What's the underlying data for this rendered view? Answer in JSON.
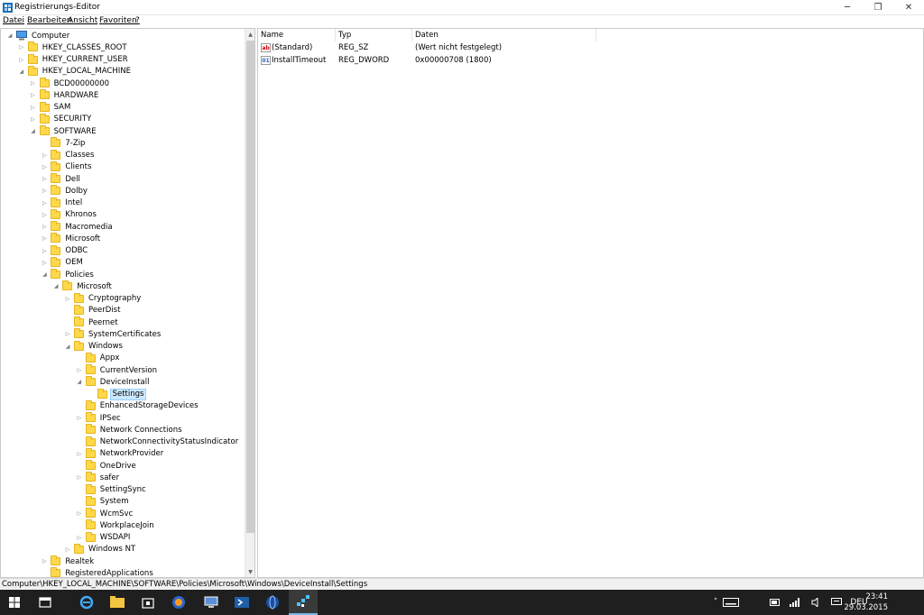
{
  "window": {
    "title": "Registrierungs-Editor",
    "minimize": "─",
    "maximize": "❐",
    "close": "✕"
  },
  "menu": [
    "Datei",
    "Bearbeiten",
    "Ansicht",
    "Favoriten",
    "?"
  ],
  "tree": {
    "items": [
      {
        "label": "Computer",
        "expander": "◢"
      },
      {
        "label": "HKEY_CLASSES_ROOT",
        "expander": "▷"
      },
      {
        "label": "HKEY_CURRENT_USER",
        "expander": "▷"
      },
      {
        "label": "HKEY_LOCAL_MACHINE",
        "expander": "◢"
      },
      {
        "label": "BCD00000000",
        "expander": "▷"
      },
      {
        "label": "HARDWARE",
        "expander": "▷"
      },
      {
        "label": "SAM",
        "expander": "▷"
      },
      {
        "label": "SECURITY",
        "expander": "▷"
      },
      {
        "label": "SOFTWARE",
        "expander": "◢"
      },
      {
        "label": "7-Zip",
        "expander": ""
      },
      {
        "label": "Classes",
        "expander": "▷"
      },
      {
        "label": "Clients",
        "expander": "▷"
      },
      {
        "label": "Dell",
        "expander": "▷"
      },
      {
        "label": "Dolby",
        "expander": "▷"
      },
      {
        "label": "Intel",
        "expander": "▷"
      },
      {
        "label": "Khronos",
        "expander": "▷"
      },
      {
        "label": "Macromedia",
        "expander": "▷"
      },
      {
        "label": "Microsoft",
        "expander": "▷"
      },
      {
        "label": "ODBC",
        "expander": "▷"
      },
      {
        "label": "OEM",
        "expander": "▷"
      },
      {
        "label": "Policies",
        "expander": "◢"
      },
      {
        "label": "Microsoft",
        "expander": "◢"
      },
      {
        "label": "Cryptography",
        "expander": "▷"
      },
      {
        "label": "PeerDist",
        "expander": ""
      },
      {
        "label": "Peernet",
        "expander": ""
      },
      {
        "label": "SystemCertificates",
        "expander": "▷"
      },
      {
        "label": "Windows",
        "expander": "◢"
      },
      {
        "label": "Appx",
        "expander": ""
      },
      {
        "label": "CurrentVersion",
        "expander": "▷"
      },
      {
        "label": "DeviceInstall",
        "expander": "◢"
      },
      {
        "label": "Settings",
        "expander": ""
      },
      {
        "label": "EnhancedStorageDevices",
        "expander": ""
      },
      {
        "label": "IPSec",
        "expander": "▷"
      },
      {
        "label": "Network Connections",
        "expander": ""
      },
      {
        "label": "NetworkConnectivityStatusIndicator",
        "expander": ""
      },
      {
        "label": "NetworkProvider",
        "expander": "▷"
      },
      {
        "label": "OneDrive",
        "expander": ""
      },
      {
        "label": "safer",
        "expander": "▷"
      },
      {
        "label": "SettingSync",
        "expander": ""
      },
      {
        "label": "System",
        "expander": ""
      },
      {
        "label": "WcmSvc",
        "expander": "▷"
      },
      {
        "label": "WorkplaceJoin",
        "expander": ""
      },
      {
        "label": "WSDAPI",
        "expander": "▷"
      },
      {
        "label": "Windows NT",
        "expander": "▷"
      },
      {
        "label": "Realtek",
        "expander": "▷"
      },
      {
        "label": "RegisteredApplications",
        "expander": ""
      }
    ],
    "selected_label": "Settings"
  },
  "values": {
    "columns": [
      "Name",
      "Typ",
      "Daten"
    ],
    "rows": [
      {
        "name": "(Standard)",
        "type": "REG_SZ",
        "data": "(Wert nicht festgelegt)",
        "icon": "ab"
      },
      {
        "name": "InstallTimeout",
        "type": "REG_DWORD",
        "data": "0x00000708 (1800)",
        "icon": "01"
      }
    ]
  },
  "status": {
    "path": "Computer\\HKEY_LOCAL_MACHINE\\SOFTWARE\\Policies\\Microsoft\\Windows\\DeviceInstall\\Settings"
  },
  "taskbar": {
    "language": "DEU",
    "time": "23:41",
    "date": "29.03.2015"
  }
}
